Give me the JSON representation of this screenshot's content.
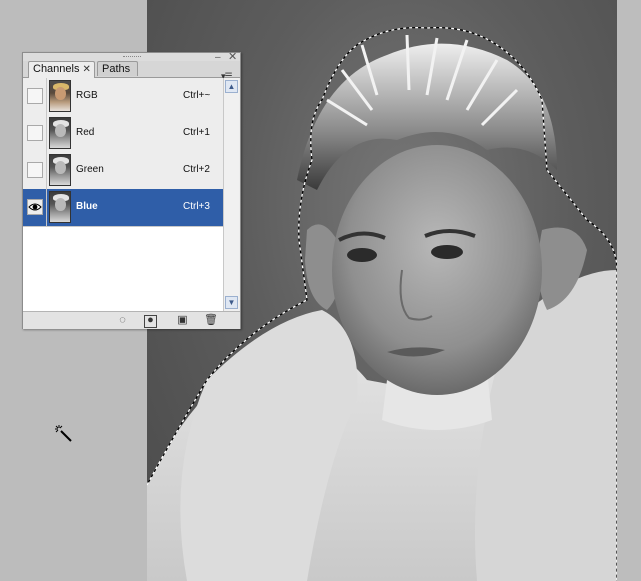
{
  "panel": {
    "tabs": [
      {
        "label": "Channels",
        "active": true
      },
      {
        "label": "Paths",
        "active": false
      }
    ],
    "channels": [
      {
        "label": "RGB",
        "shortcut": "Ctrl+~",
        "visible": false,
        "selected": false,
        "thumb": "color"
      },
      {
        "label": "Red",
        "shortcut": "Ctrl+1",
        "visible": false,
        "selected": false,
        "thumb": "gray"
      },
      {
        "label": "Green",
        "shortcut": "Ctrl+2",
        "visible": false,
        "selected": false,
        "thumb": "gray"
      },
      {
        "label": "Blue",
        "shortcut": "Ctrl+3",
        "visible": true,
        "selected": true,
        "thumb": "gray"
      }
    ],
    "footer_buttons": [
      "load-selection-icon",
      "save-selection-icon",
      "new-channel-icon",
      "trash-icon"
    ]
  },
  "colors": {
    "selected_row": "#2f5ea8",
    "canvas_bg": "#5d5d5d",
    "workspace_bg": "#bcbcbc"
  },
  "tool": "magic-wand-icon"
}
